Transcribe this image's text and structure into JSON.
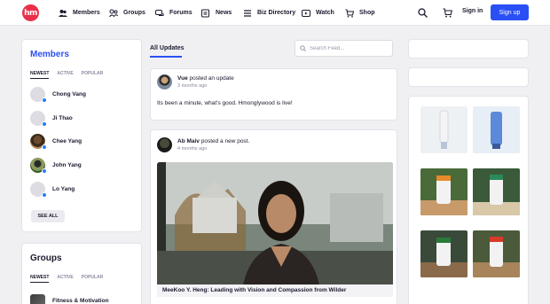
{
  "header": {
    "logo_text": "hm",
    "nav": [
      {
        "label": "Members",
        "icon": "members-icon"
      },
      {
        "label": "Groups",
        "icon": "groups-icon"
      },
      {
        "label": "Forums",
        "icon": "forums-icon"
      },
      {
        "label": "News",
        "icon": "news-icon"
      },
      {
        "label": "Biz Directory",
        "icon": "directory-icon"
      },
      {
        "label": "Watch",
        "icon": "watch-icon"
      },
      {
        "label": "Shop",
        "icon": "shop-icon"
      }
    ],
    "sign_in": "Sign in",
    "sign_up": "Sign up",
    "accent": "#2a4ff5",
    "brand": "#e8304a"
  },
  "members_widget": {
    "title": "Members",
    "tabs": [
      "NEWEST",
      "ACTIVE",
      "POPULAR"
    ],
    "members": [
      {
        "name": "Chong Vang"
      },
      {
        "name": "Ji Thao"
      },
      {
        "name": "Chee Yang"
      },
      {
        "name": "John Yang"
      },
      {
        "name": "Lo Yang"
      }
    ],
    "see_all": "SEE ALL"
  },
  "groups_widget": {
    "title": "Groups",
    "tabs": [
      "NEWEST",
      "ACTIVE",
      "POPULAR"
    ],
    "groups": [
      {
        "name": "Fitness & Motivation"
      }
    ]
  },
  "feed": {
    "tab": "All Updates",
    "search_placeholder": "Search Feed...",
    "posts": [
      {
        "author": "Vue",
        "action": " posted an update",
        "time": "3 months ago",
        "text": "Its been a minute, what's good. Hmonglywood is live!"
      },
      {
        "author": "Ab Maiv",
        "action": " posted a new post.",
        "time": "4 months ago",
        "video_caption": "MeeKoo Y. Heng: Leading with Vision and Compassion from Wilder"
      }
    ]
  }
}
